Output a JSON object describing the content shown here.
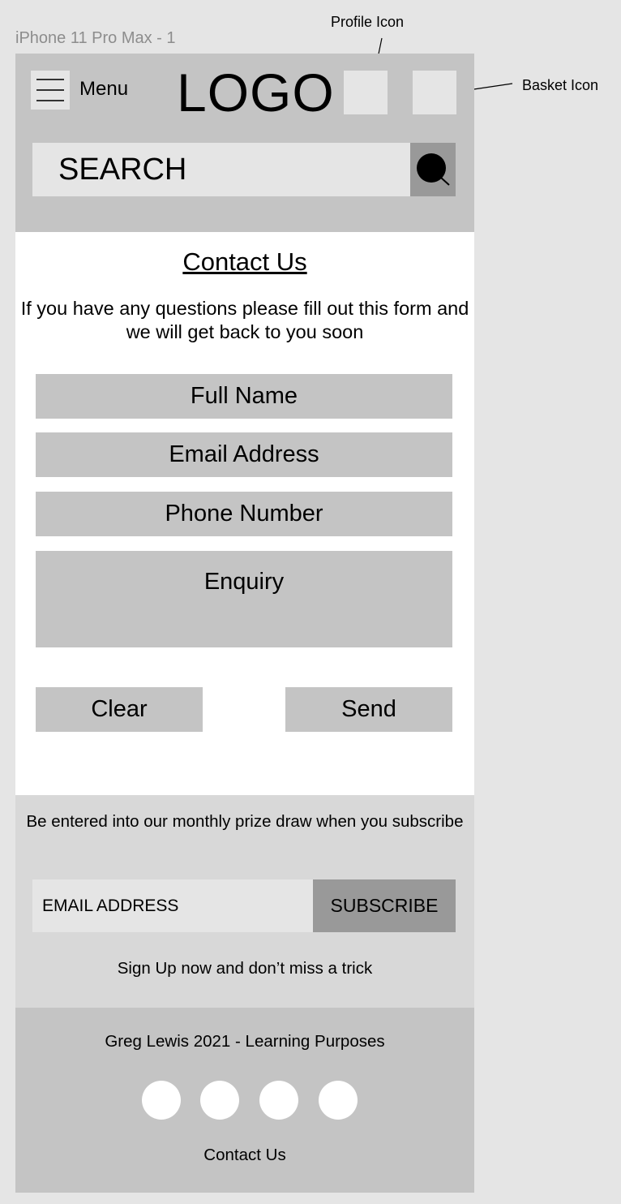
{
  "frame": {
    "label": "iPhone 11 Pro Max - 1"
  },
  "annotations": {
    "profile": "Profile Icon",
    "basket": "Basket Icon"
  },
  "header": {
    "menu_label": "Menu",
    "logo": "LOGO",
    "search_placeholder": "SEARCH",
    "icons": [
      "menu-icon",
      "profile-icon",
      "basket-icon",
      "search-icon"
    ]
  },
  "contact": {
    "title": "Contact Us",
    "intro": "If you have any questions please fill out this form and we will get back to you soon",
    "fields": {
      "full_name": "Full Name",
      "email": "Email Address",
      "phone": "Phone Number",
      "enquiry": "Enquiry"
    },
    "buttons": {
      "clear": "Clear",
      "send": "Send"
    }
  },
  "subscribe": {
    "promo": "Be entered into our monthly prize draw when you subscribe",
    "email_placeholder": "EMAIL ADDRESS",
    "button": "SUBSCRIBE",
    "signup_text": "Sign Up now and don’t miss a trick"
  },
  "footer": {
    "credit": "Greg Lewis 2021 - Learning Purposes",
    "social_icons": [
      "social-icon-1",
      "social-icon-2",
      "social-icon-3",
      "social-icon-4"
    ],
    "contact_link": "Contact Us"
  },
  "colors": {
    "page_bg": "#e5e5e5",
    "header_bg": "#c4c4c4",
    "field_bg": "#c4c4c4",
    "subscribe_bg": "#d8d8d8",
    "search_button_bg": "#999999"
  }
}
